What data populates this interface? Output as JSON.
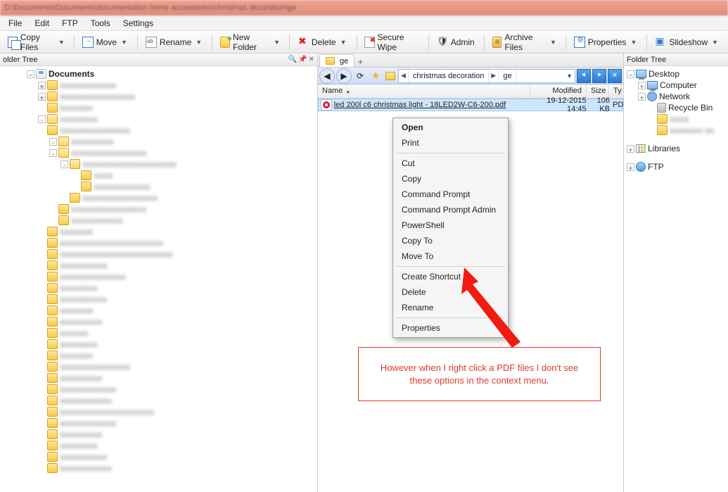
{
  "title_blur": "D:\\Documents\\Documents\\documentation home accessories\\christmas decoration\\ge",
  "menu": {
    "file": "File",
    "edit": "Edit",
    "ftp": "FTP",
    "tools": "Tools",
    "settings": "Settings"
  },
  "toolbar": {
    "copy": "Copy Files",
    "move": "Move",
    "rename": "Rename",
    "newfolder": "New Folder",
    "delete": "Delete",
    "secure": "Secure Wipe",
    "admin": "Admin",
    "archive": "Archive Files",
    "properties": "Properties",
    "slideshow": "Slideshow"
  },
  "left_panel": {
    "header": "older Tree",
    "root": "Documents"
  },
  "center": {
    "tab": "ge",
    "breadcrumb": {
      "parent": "christmas decoration",
      "leaf": "ge"
    },
    "cols": {
      "name": "Name",
      "modified": "Modified",
      "size": "Size",
      "type": "Ty"
    },
    "file": {
      "name": "led 200l c6 christmas light -  18LED2W-C6-200.pdf",
      "modified": "19-12-2015  14:45",
      "size": "106 KB",
      "type": "PD"
    }
  },
  "context": {
    "open": "Open",
    "print": "Print",
    "cut": "Cut",
    "copy": "Copy",
    "cmd": "Command Prompt",
    "cmda": "Command Prompt Admin",
    "ps": "PowerShell",
    "copyto": "Copy To",
    "moveto": "Move To",
    "shortcut": "Create Shortcut",
    "delete": "Delete",
    "rename": "Rename",
    "properties": "Properties"
  },
  "callout": "However when I right click a PDF files I don't see these options in the context menu.",
  "right_panel": {
    "header": "Folder Tree",
    "desktop": "Desktop",
    "computer": "Computer",
    "network": "Network",
    "recycle": "Recycle Bin",
    "libraries": "Libraries",
    "ftp": "FTP"
  }
}
